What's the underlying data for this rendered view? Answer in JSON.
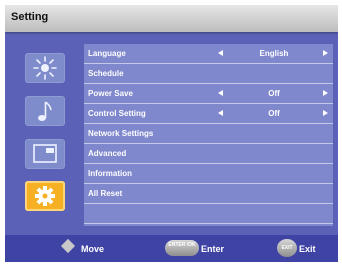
{
  "window": {
    "title": "Setting"
  },
  "sidebar": {
    "items": [
      {
        "icon": "brightness-icon",
        "active": false
      },
      {
        "icon": "music-note-icon",
        "active": false
      },
      {
        "icon": "screen-icon",
        "active": false
      },
      {
        "icon": "gear-icon",
        "active": true
      }
    ]
  },
  "menu": {
    "items": [
      {
        "label": "Language",
        "value": "English",
        "has_arrows": true
      },
      {
        "label": "Schedule"
      },
      {
        "label": "Power Save",
        "value": "Off",
        "has_arrows": true
      },
      {
        "label": "Control Setting",
        "value": "Off",
        "has_arrows": true
      },
      {
        "label": "Network Settings"
      },
      {
        "label": "Advanced"
      },
      {
        "label": "Information"
      },
      {
        "label": "All Reset"
      }
    ]
  },
  "footer": {
    "move_label": "Move",
    "enter_button": "ENTER /OK",
    "enter_label": "Enter",
    "exit_button": "EXIT",
    "exit_label": "Exit"
  },
  "colors": {
    "background": "#5a61b6",
    "panel": "#7f87cd",
    "active_icon": "#f6b024",
    "footer": "#3f44a4"
  }
}
